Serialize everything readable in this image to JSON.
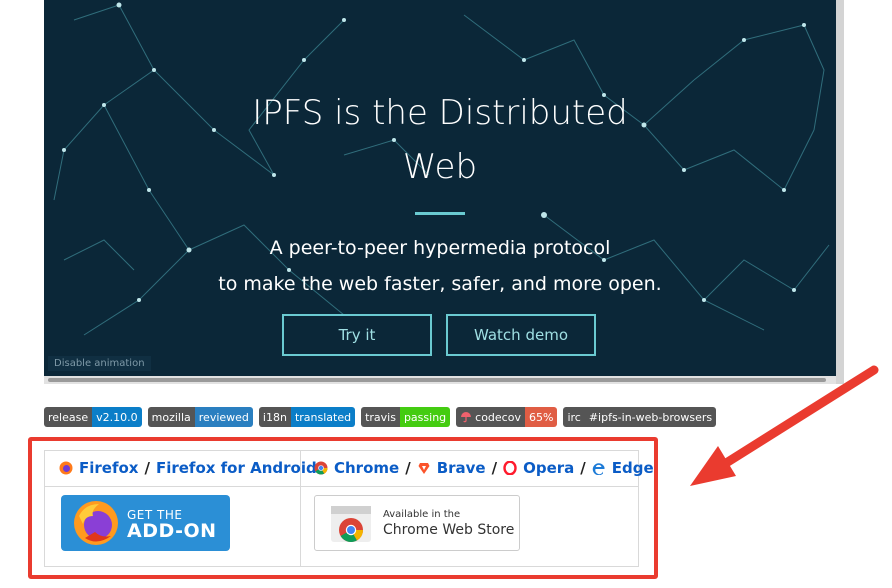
{
  "hero": {
    "title_line1": "IPFS is the Distributed",
    "title_line2": "Web",
    "subtitle_line1": "A peer-to-peer hypermedia protocol",
    "subtitle_line2": "to make the web faster, safer, and more open.",
    "try_button": "Try it",
    "watch_button": "Watch demo",
    "disable_animation": "Disable animation"
  },
  "badges": [
    {
      "key": "release",
      "value": "v2.10.0",
      "color": "#0b7ec8"
    },
    {
      "key": "mozilla",
      "value": "reviewed",
      "color": "#2a7fc0"
    },
    {
      "key": "i18n",
      "value": "translated",
      "color": "#0b7ec8"
    },
    {
      "key": "travis",
      "value": "passing",
      "color": "#44cc11"
    },
    {
      "key": "codecov",
      "value": "65%",
      "color": "#e05d44"
    },
    {
      "key": "irc",
      "value": "#ipfs-in-web-browsers",
      "color": "#555555"
    }
  ],
  "stores": {
    "left_header": {
      "firefox": "Firefox",
      "separator": "/",
      "firefox_android": "Firefox for Android"
    },
    "right_header": {
      "chrome": "Chrome",
      "brave": "Brave",
      "opera": "Opera",
      "edge": "Edge",
      "separator": "/"
    },
    "firefox_button": {
      "line1": "GET THE",
      "line2": "ADD-ON"
    },
    "chrome_button": {
      "line1": "Available in the",
      "line2": "Chrome Web Store"
    }
  },
  "colors": {
    "hero_bg": "#0b2738",
    "accent_teal": "#6acad1",
    "link_blue": "#0b5cc6",
    "highlight_red": "#ea3b2f"
  }
}
